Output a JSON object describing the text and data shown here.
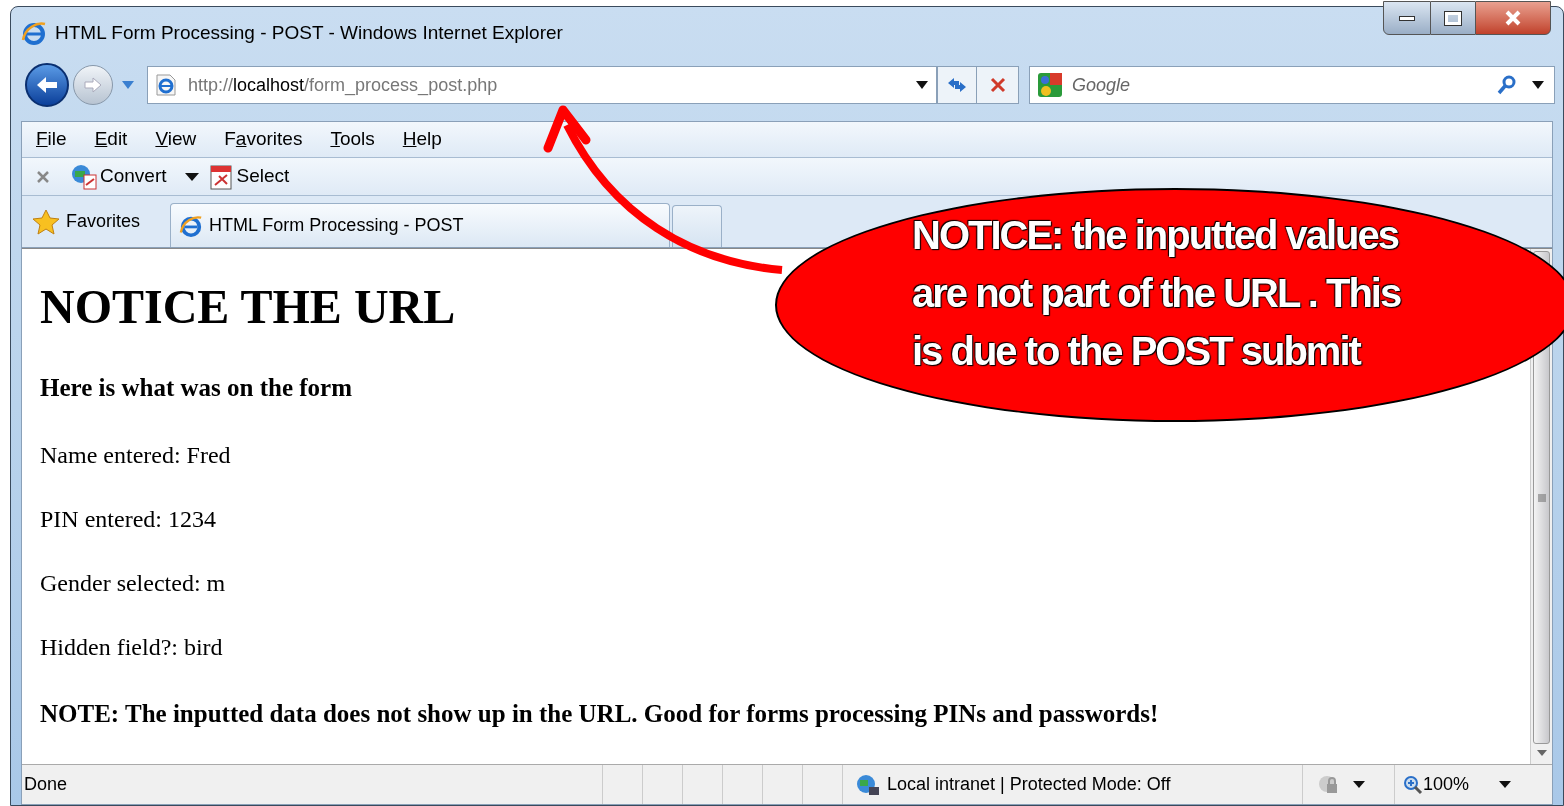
{
  "window": {
    "title": "HTML Form Processing - POST - Windows Internet Explorer"
  },
  "address_bar": {
    "url_parts": [
      {
        "text": "http://",
        "kind": "dim"
      },
      {
        "text": "localhost",
        "kind": "host"
      },
      {
        "text": "/form_process_post.php",
        "kind": "dim"
      }
    ]
  },
  "search": {
    "placeholder": "Google"
  },
  "menu": [
    {
      "key": "F",
      "post": "ile"
    },
    {
      "key": "E",
      "post": "dit"
    },
    {
      "key": "V",
      "post": "iew"
    },
    {
      "pre": "F",
      "key": "a",
      "post": "vorites"
    },
    {
      "key": "T",
      "post": "ools"
    },
    {
      "key": "H",
      "post": "elp"
    }
  ],
  "command_bar": {
    "convert": "Convert",
    "select": "Select"
  },
  "favorites_bar": {
    "label": "Favorites"
  },
  "tabs": [
    {
      "label": "HTML Form Processing - POST",
      "selected": true
    }
  ],
  "page": {
    "heading": "NOTICE THE URL",
    "subheading": "Here is what was on the form",
    "lines": [
      "Name entered: Fred",
      "PIN entered: 1234",
      "Gender selected: m",
      "Hidden field?: bird"
    ],
    "note": "NOTE: The inputted data does not show up in the URL. Good for forms processing PINs and passwords!"
  },
  "status_bar": {
    "status": "Done",
    "zone": "Local intranet | Protected Mode: Off",
    "zoom": "100%"
  },
  "callout": {
    "text": "NOTICE: the inputted values are not part of the URL . This is due to the POST submit"
  }
}
